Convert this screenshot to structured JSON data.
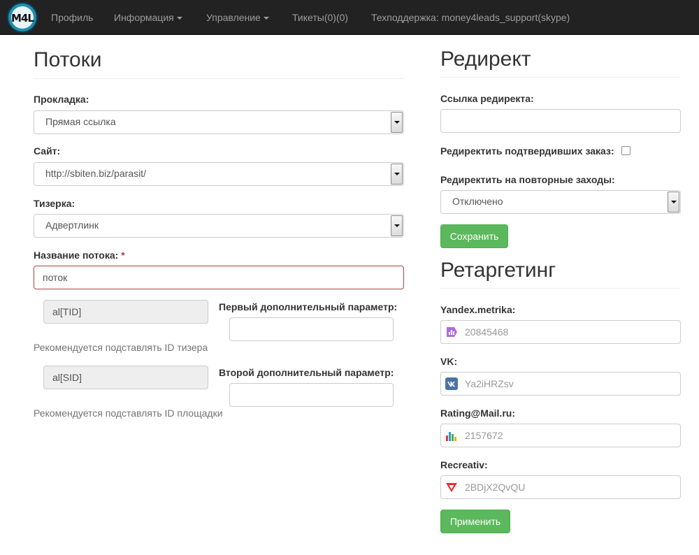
{
  "navbar": {
    "logo_text": "M4L",
    "items": [
      {
        "label": "Профиль"
      },
      {
        "label": "Информация"
      },
      {
        "label": "Управление"
      },
      {
        "label": "Тикеты(0)(0)"
      },
      {
        "label": "Техподдержка: money4leads_support(skype)"
      }
    ]
  },
  "streams": {
    "title": "Потоки",
    "landing": {
      "label": "Прокладка:",
      "value": "Прямая ссылка"
    },
    "site": {
      "label": "Сайт:",
      "value": "http://sbiten.biz/parasit/"
    },
    "teaser": {
      "label": "Тизерка:",
      "value": "Адвертлинк"
    },
    "name": {
      "label": "Название потока:",
      "required_mark": "*",
      "value": "поток"
    },
    "param1": {
      "macro": "al[TID]",
      "label": "Первый дополнительный параметр:",
      "value": "",
      "help": "Рекомендуется подставлять ID тизера"
    },
    "param2": {
      "macro": "al[SID]",
      "label": "Второй дополнительный параметр:",
      "value": "",
      "help": "Рекомендуется подставлять ID площадки"
    }
  },
  "redirect": {
    "title": "Редирект",
    "link": {
      "label": "Ссылка редиректа:",
      "value": ""
    },
    "confirmed": {
      "label": "Редиректить подтвердивших заказ:",
      "checked": false
    },
    "repeat": {
      "label": "Редиректить на повторные заходы:",
      "value": "Отключено"
    },
    "save_label": "Сохранить"
  },
  "retargeting": {
    "title": "Ретаргетинг",
    "fields": [
      {
        "label": "Yandex.metrika:",
        "placeholder": "20845468",
        "icon": "yandex-metrika-icon"
      },
      {
        "label": "VK:",
        "placeholder": "Ya2iHRZsv",
        "icon": "vk-icon"
      },
      {
        "label": "Rating@Mail.ru:",
        "placeholder": "2157672",
        "icon": "mail-rating-icon"
      },
      {
        "label": "Recreativ:",
        "placeholder": "2BDjX2QvQU",
        "icon": "recreativ-icon"
      }
    ],
    "apply_label": "Применить"
  },
  "colors": {
    "navbar_bg": "#222222",
    "success": "#5cb85c",
    "error_border": "#a94442",
    "help_text": "#737373"
  }
}
